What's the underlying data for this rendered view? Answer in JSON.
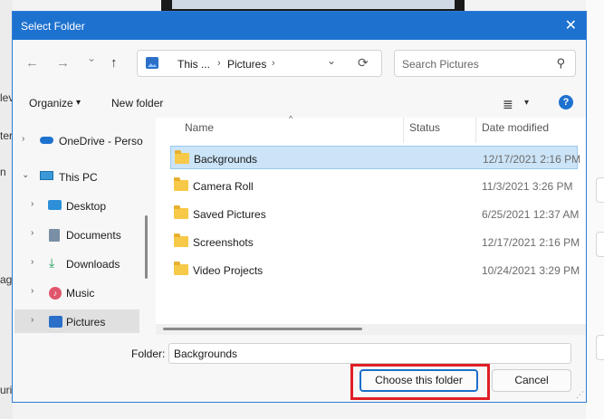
{
  "background": {
    "fragments": [
      "lev",
      "ter",
      "n",
      "ag",
      "uri"
    ]
  },
  "dialog": {
    "title": "Select Folder",
    "close_label": "✕"
  },
  "nav": {
    "back": "←",
    "forward": "→",
    "recent": "⌄",
    "up": "↑",
    "refresh": "⟳"
  },
  "address": {
    "root": "This ...",
    "current": "Pictures",
    "sep": "›",
    "dropdown": "⌄"
  },
  "search": {
    "placeholder": "Search Pictures",
    "icon": "⚲"
  },
  "toolbar": {
    "organize": "Organize",
    "organize_caret": "▾",
    "new_folder": "New folder",
    "view_icon": "≣",
    "view_caret": "▾",
    "help": "?"
  },
  "tree": [
    {
      "label": "OneDrive - Perso",
      "icon": "cloud-icon",
      "expanded": false,
      "selected": false
    },
    {
      "label": "This PC",
      "icon": "computer-icon",
      "expanded": true,
      "selected": false
    },
    {
      "label": "Desktop",
      "icon": "desktop-icon",
      "expanded": false,
      "selected": false
    },
    {
      "label": "Documents",
      "icon": "documents-icon",
      "expanded": false,
      "selected": false
    },
    {
      "label": "Downloads",
      "icon": "download-icon",
      "expanded": false,
      "selected": false
    },
    {
      "label": "Music",
      "icon": "music-icon",
      "expanded": false,
      "selected": false
    },
    {
      "label": "Pictures",
      "icon": "pictures-icon",
      "expanded": false,
      "selected": true
    }
  ],
  "columns": {
    "name": "Name",
    "status": "Status",
    "date": "Date modified",
    "sort": "^"
  },
  "files": [
    {
      "name": "Backgrounds",
      "date": "12/17/2021 2:16 PM",
      "selected": true
    },
    {
      "name": "Camera Roll",
      "date": "11/3/2021 3:26 PM",
      "selected": false
    },
    {
      "name": "Saved Pictures",
      "date": "6/25/2021 12:37 AM",
      "selected": false
    },
    {
      "name": "Screenshots",
      "date": "12/17/2021 2:16 PM",
      "selected": false
    },
    {
      "name": "Video Projects",
      "date": "10/24/2021 3:29 PM",
      "selected": false
    }
  ],
  "footer": {
    "folder_label": "Folder:",
    "folder_value": "Backgrounds",
    "choose_label": "Choose this folder",
    "cancel_label": "Cancel"
  },
  "colors": {
    "title_bar": "#1e72cf",
    "selection": "#cce4f7",
    "highlight": "#e01f26"
  }
}
